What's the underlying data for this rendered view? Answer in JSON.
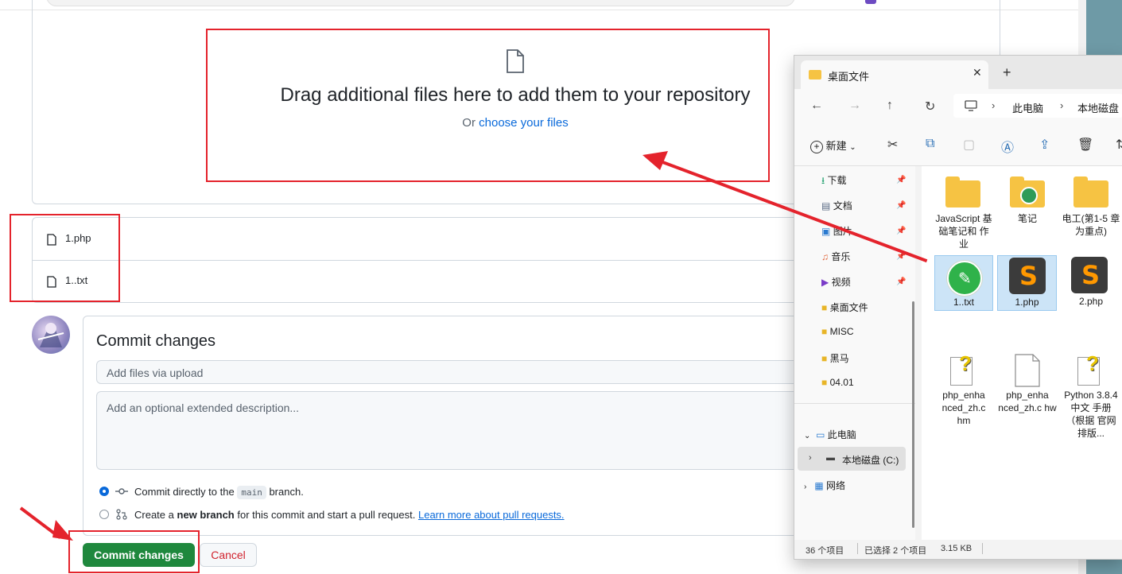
{
  "upload": {
    "drop_title": "Drag additional files here to add them to your repository",
    "or_text": "Or",
    "choose_link": "choose your files",
    "files": [
      "1.php",
      "1..txt"
    ]
  },
  "commit": {
    "heading": "Commit changes",
    "summary_placeholder": "Add files via upload",
    "description_placeholder": "Add an optional extended description...",
    "option1_prefix": "Commit directly to the",
    "option1_branch": "main",
    "option1_suffix": "branch.",
    "option2_prefix": "Create a",
    "option2_bold": "new branch",
    "option2_mid": "for this commit and start a pull request.",
    "option2_link": "Learn more about pull requests.",
    "commit_button": "Commit changes",
    "cancel_button": "Cancel"
  },
  "explorer": {
    "tab_title": "桌面文件",
    "breadcrumb": [
      "此电脑",
      "本地磁盘"
    ],
    "new_button": "新建",
    "sidebar": [
      {
        "label": "下载",
        "pinned": true
      },
      {
        "label": "文档",
        "pinned": true
      },
      {
        "label": "图片",
        "pinned": true
      },
      {
        "label": "音乐",
        "pinned": true
      },
      {
        "label": "视频",
        "pinned": true
      },
      {
        "label": "桌面文件",
        "pinned": false
      },
      {
        "label": "MISC",
        "pinned": false
      },
      {
        "label": "黑马",
        "pinned": false
      },
      {
        "label": "04.01",
        "pinned": false
      }
    ],
    "this_pc": "此电脑",
    "local_disk": "本地磁盘 (C:)",
    "network": "网络",
    "items": [
      {
        "label": "JavaScript 基础笔记和 作业",
        "kind": "folder"
      },
      {
        "label": "笔记",
        "kind": "folder"
      },
      {
        "label": "电工(第1-5 章为重点)",
        "kind": "folder"
      },
      {
        "label": "1..txt",
        "kind": "txt"
      },
      {
        "label": "1.php",
        "kind": "sublime"
      },
      {
        "label": "2.php",
        "kind": "sublime"
      },
      {
        "label": "php_enha nced_zh.c hm",
        "kind": "help"
      },
      {
        "label": "php_enha nced_zh.c hw",
        "kind": "file"
      },
      {
        "label": "Python 3.8.4 中文 手册（根据 官网排版...",
        "kind": "help"
      }
    ],
    "status_count": "36 个项目",
    "status_selected": "已选择 2 个项目",
    "status_size": "3.15 KB"
  },
  "colors": {
    "annotation_red": "#e4232c",
    "commit_green": "#1f883d",
    "link_blue": "#0969da"
  }
}
